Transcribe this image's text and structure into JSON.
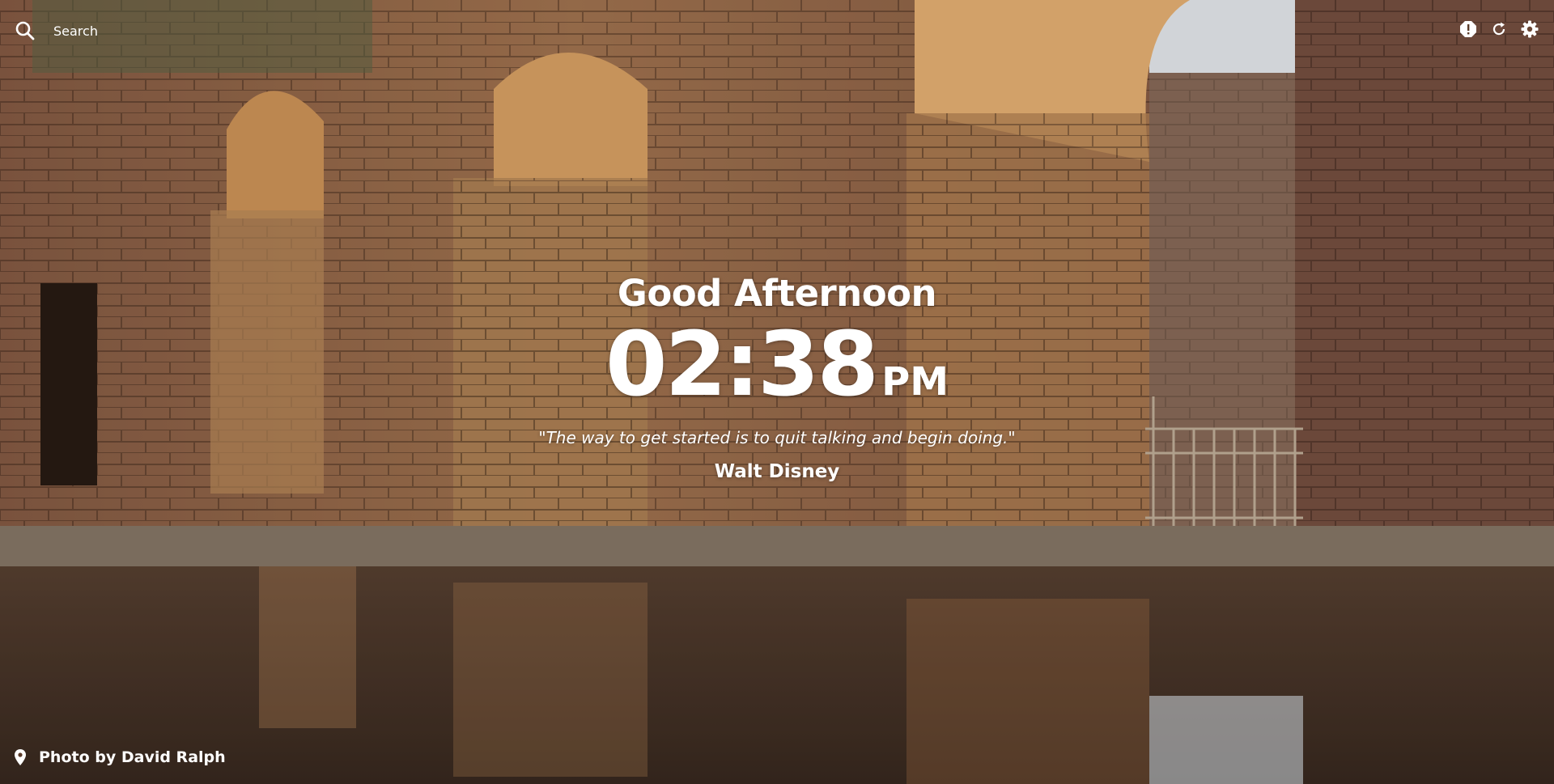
{
  "search": {
    "placeholder": "Search",
    "icon": "search-icon"
  },
  "toolbar": {
    "buttons": [
      {
        "icon": "alert-icon"
      },
      {
        "icon": "refresh-icon"
      },
      {
        "icon": "settings-icon"
      }
    ]
  },
  "main": {
    "greeting": "Good Afternoon",
    "time": "02:38",
    "ampm": "PM",
    "quote": "\"The way to get started is to quit talking and begin doing.\"",
    "author": "Walt Disney"
  },
  "footer": {
    "photo_credit": "Photo by David Ralph",
    "icon": "location-pin-icon"
  },
  "colors": {
    "text": "#ffffff",
    "sandstone": "#9c6a4c",
    "sky": "#eef2f6"
  }
}
